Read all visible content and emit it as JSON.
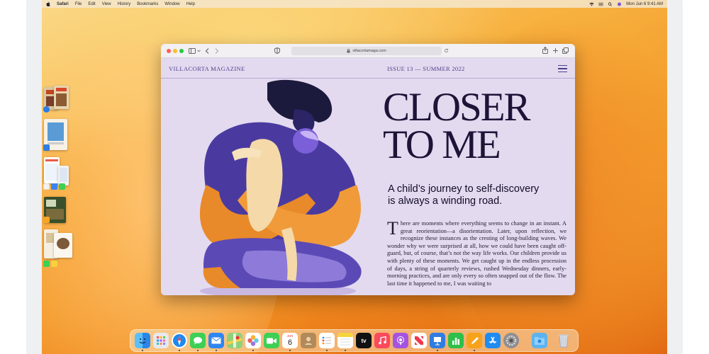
{
  "menubar": {
    "app_name": "Safari",
    "items": [
      "File",
      "Edit",
      "View",
      "History",
      "Bookmarks",
      "Window",
      "Help"
    ],
    "clock": "Mon Jun 6  9:41 AM"
  },
  "safari": {
    "url": "villacortamaga.com"
  },
  "magazine": {
    "name": "VILLACORTA MAGAZINE",
    "issue": "ISSUE 13 — SUMMER 2022",
    "headline": "CLOSER\nTO ME",
    "subhead": "A child’s journey to self-discovery\nis always a winding road.",
    "dropcap": "T",
    "body": "here are moments where everything seems to change in an instant. A great reorientation—a disorientation. Later, upon reflection, we recognize these instances as the cresting of long-building waves. We wonder why we were surprised at all, how we could have been caught off-guard, but, of course, that’s not the way life works. Our children provide us with plenty of these moments. We get caught up in the endless procession of days, a string of quarterly reviews, rushed Wednesday dinners, early-morning practices, and are only every so often snapped out of the flow. The last time it happened to me, I was waiting to"
  },
  "dock": {
    "calendar_month": "JUN",
    "calendar_day": "6",
    "tv_label": "tv",
    "apps": [
      "finder-icon",
      "launchpad-icon",
      "safari-icon",
      "messages-icon",
      "mail-icon",
      "maps-icon",
      "photos-icon",
      "facetime-icon",
      "calendar-icon",
      "contacts-icon",
      "reminders-icon",
      "notes-icon",
      "tv-icon",
      "music-icon",
      "podcasts-icon",
      "news-icon",
      "keynote-icon",
      "numbers-icon",
      "pages-icon",
      "app-store-icon",
      "system-settings-icon",
      "downloads-folder-icon",
      "trash-icon"
    ]
  },
  "colors": {
    "magazine_accent": "#4e3f8a",
    "page_background": "#e4daf0",
    "headline": "#1d1438"
  }
}
